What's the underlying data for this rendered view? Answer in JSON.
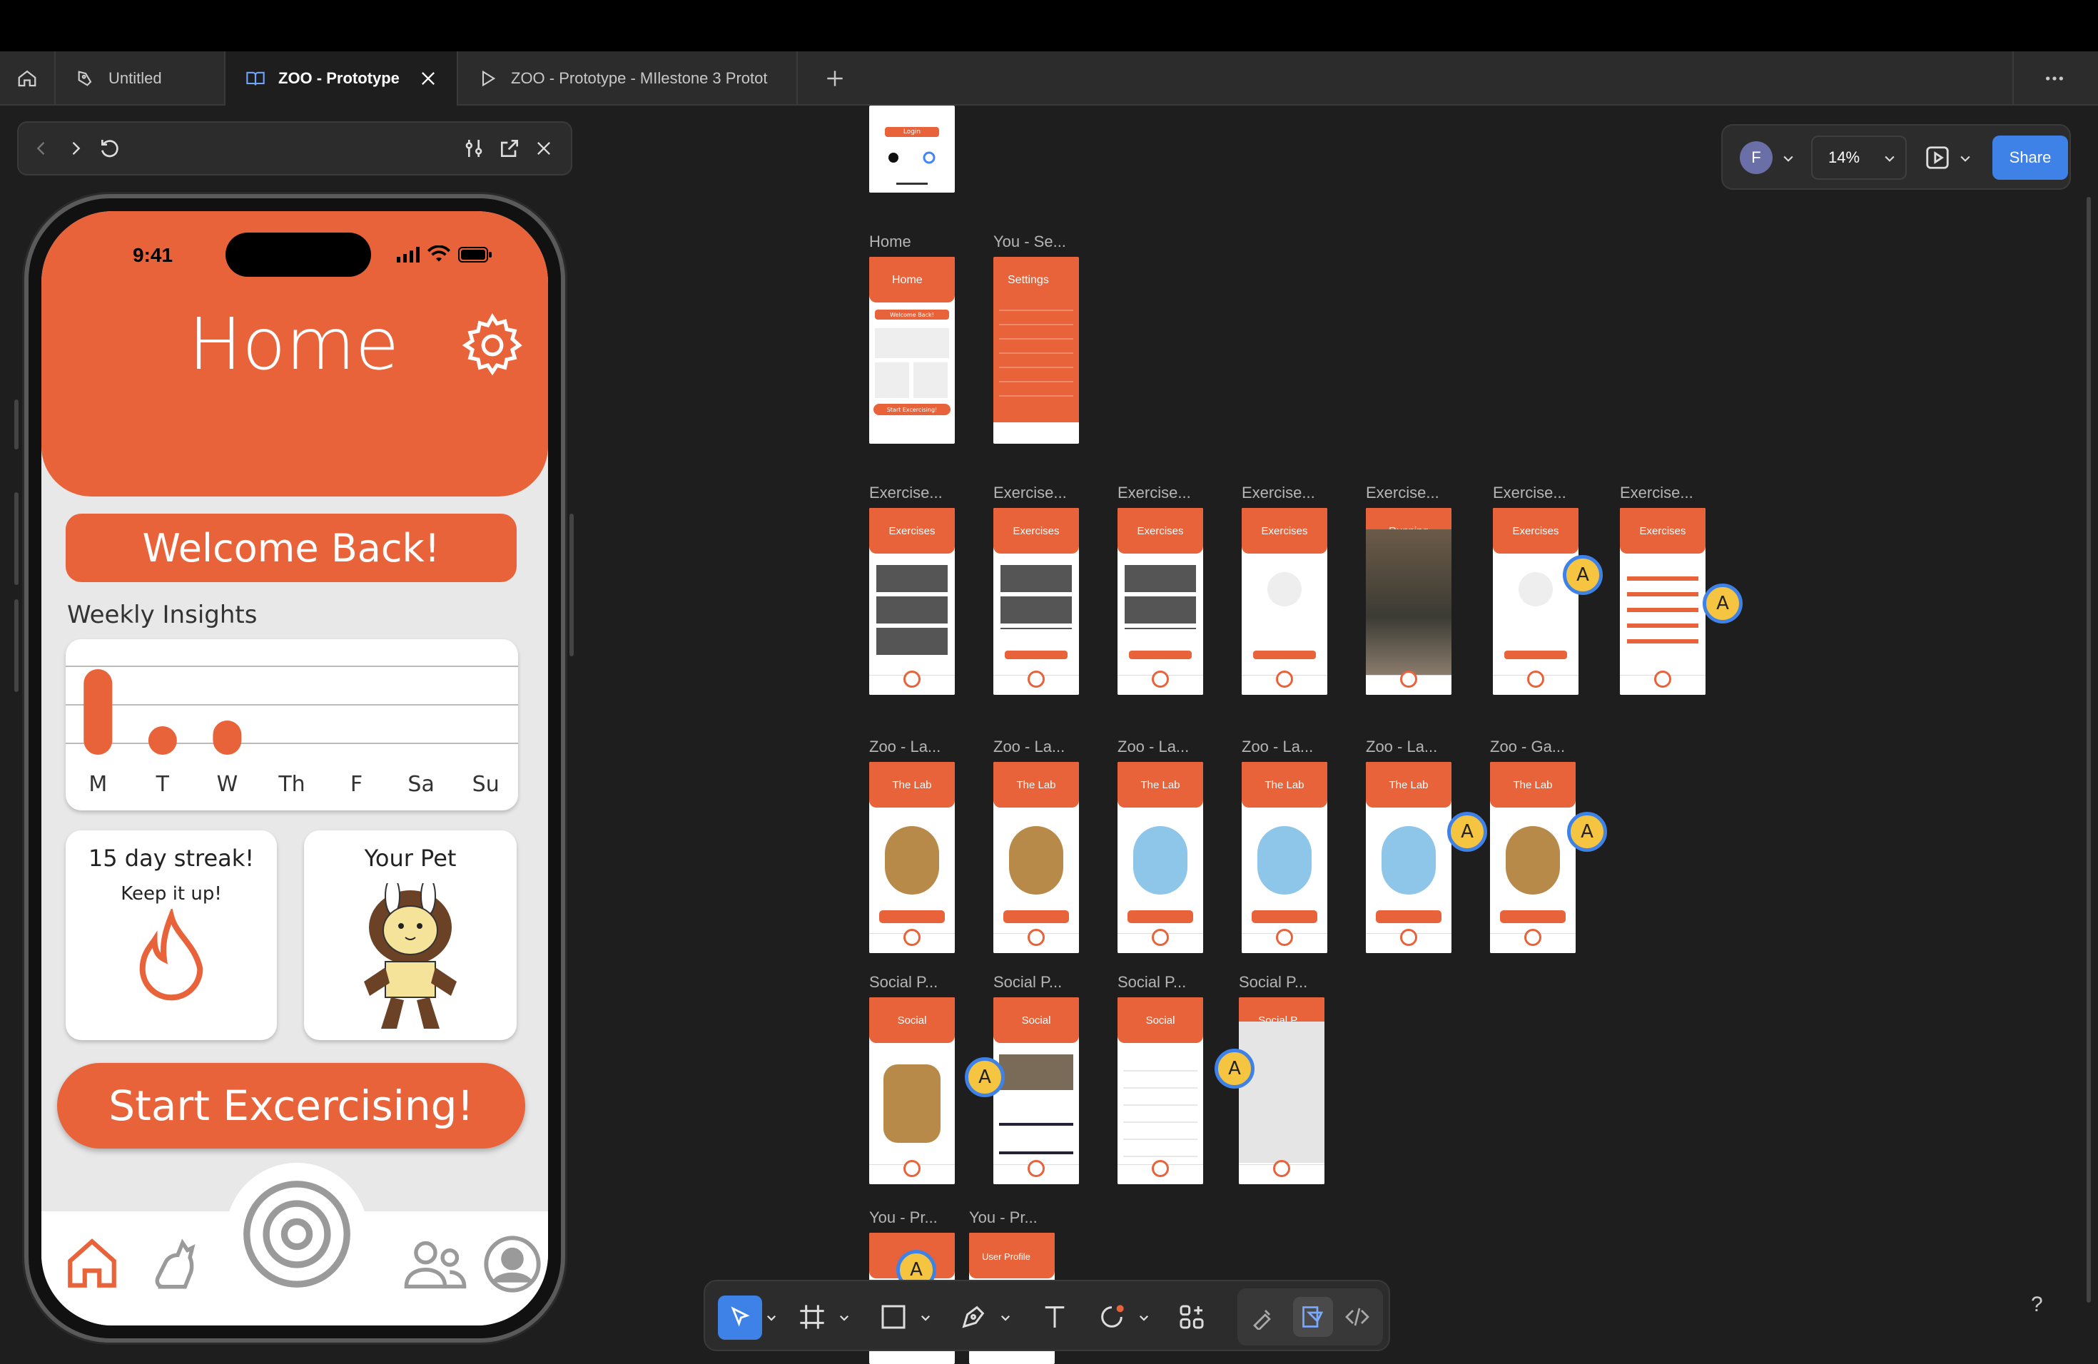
{
  "tabs": [
    {
      "label": "Untitled"
    },
    {
      "label": "ZOO - Prototype"
    },
    {
      "label": "ZOO - Prototype - MIlestone 3 Protot"
    }
  ],
  "toolbar": {
    "user_initial": "F",
    "zoom": "14%",
    "share_label": "Share",
    "help": "?"
  },
  "phone": {
    "time": "9:41",
    "title": "Home",
    "welcome": "Welcome Back!",
    "insights_label": "Weekly Insights",
    "days": [
      "M",
      "T",
      "W",
      "Th",
      "F",
      "Sa",
      "Su"
    ],
    "weekly_activity": [
      5,
      1,
      2,
      0,
      0,
      0,
      0
    ],
    "streak_title": "15 day streak!",
    "streak_sub": "Keep it up!",
    "pet_title": "Your Pet",
    "start_button": "Start Excercising!"
  },
  "frames": {
    "home": "Home",
    "you_settings": "You - Se...",
    "settings_title": "Settings",
    "exercise": "Exercise...",
    "exercises_title": "Exercises",
    "running_title": "Running",
    "zoo_lab": "Zoo - La...",
    "zoo_gallery": "Zoo - Ga...",
    "lab_title": "The Lab",
    "social": "Social P...",
    "social_title": "Social",
    "you_profile": "You - Pr...",
    "user_profile_title": "User Profile",
    "login_label": "Login",
    "welcome_small": "Welcome Back!",
    "start_small": "Start Excercising!"
  },
  "comments": [
    "A",
    "A",
    "A",
    "A",
    "A",
    "A",
    "A"
  ],
  "colors": {
    "accent": "#e8623a",
    "canvas": "#1e1e1e",
    "share": "#3e82e8"
  }
}
